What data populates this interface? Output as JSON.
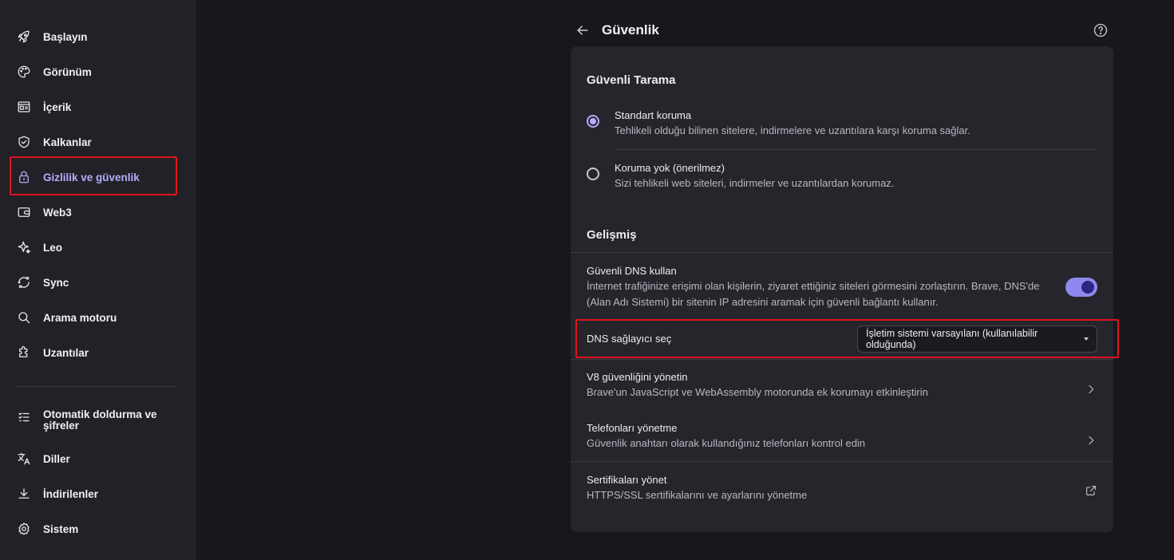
{
  "sidebar": {
    "items": [
      {
        "label": "Başlayın",
        "icon": "rocket-icon"
      },
      {
        "label": "Görünüm",
        "icon": "palette-icon"
      },
      {
        "label": "İçerik",
        "icon": "content-icon"
      },
      {
        "label": "Kalkanlar",
        "icon": "shield-icon"
      },
      {
        "label": "Gizlilik ve güvenlik",
        "icon": "lock-icon"
      },
      {
        "label": "Web3",
        "icon": "wallet-icon"
      },
      {
        "label": "Leo",
        "icon": "sparkle-icon"
      },
      {
        "label": "Sync",
        "icon": "sync-icon"
      },
      {
        "label": "Arama motoru",
        "icon": "search-icon"
      },
      {
        "label": "Uzantılar",
        "icon": "puzzle-icon"
      },
      {
        "label": "Otomatik doldurma ve şifreler",
        "icon": "list-icon"
      },
      {
        "label": "Diller",
        "icon": "translate-icon"
      },
      {
        "label": "İndirilenler",
        "icon": "download-icon"
      },
      {
        "label": "Sistem",
        "icon": "gear-icon"
      }
    ]
  },
  "header": {
    "title": "Güvenlik"
  },
  "safe_browsing": {
    "title": "Güvenli Tarama",
    "options": [
      {
        "title": "Standart koruma",
        "desc": "Tehlikeli olduğu bilinen sitelere, indirmelere ve uzantılara karşı koruma sağlar.",
        "selected": true
      },
      {
        "title": "Koruma yok (önerilmez)",
        "desc": "Sizi tehlikeli web siteleri, indirmeler ve uzantılardan korumaz.",
        "selected": false
      }
    ]
  },
  "advanced": {
    "title": "Gelişmiş",
    "secure_dns": {
      "title": "Güvenli DNS kullan",
      "desc_line1": "İnternet trafiğinize erişimi olan kişilerin, ziyaret ettiğiniz siteleri görmesini zorlaştırın. Brave, DNS'de",
      "desc_line2": "(Alan Adı Sistemi) bir sitenin IP adresini aramak için güvenli bağlantı kullanır.",
      "enabled": true
    },
    "dns_provider": {
      "label": "DNS sağlayıcı seç",
      "selected": "İşletim sistemi varsayılanı (kullanılabilir olduğunda)"
    },
    "v8": {
      "title": "V8 güvenliğini yönetin",
      "desc": "Brave'un JavaScript ve WebAssembly motorunda ek korumayı etkinleştirin"
    },
    "phones": {
      "title": "Telefonları yönetme",
      "desc": "Güvenlik anahtarı olarak kullandığınız telefonları kontrol edin"
    },
    "certs": {
      "title": "Sertifikaları yönet",
      "desc": "HTTPS/SSL sertifikalarını ve ayarlarını yönetme"
    }
  },
  "colors": {
    "accent": "#b3aef8",
    "highlight": "#e0141d",
    "toggle_on": "#8f88ee"
  }
}
